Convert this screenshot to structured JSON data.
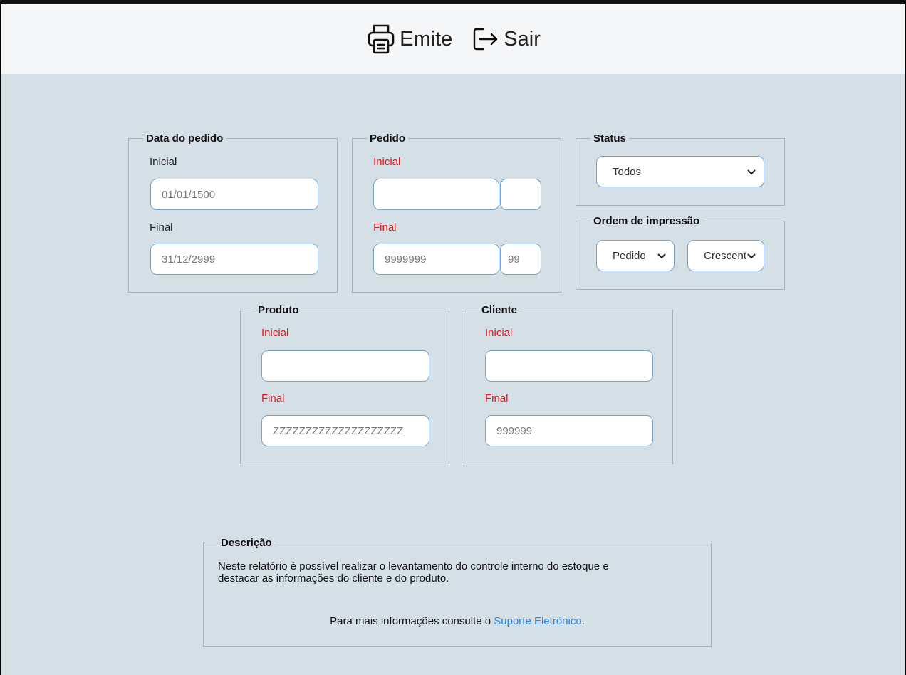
{
  "toolbar": {
    "emit_label": "Emite",
    "exit_label": "Sair"
  },
  "data_pedido": {
    "legend": "Data do pedido",
    "initial_label": "Inicial",
    "initial_placeholder": "01/01/1500",
    "final_label": "Final",
    "final_placeholder": "31/12/2999"
  },
  "pedido": {
    "legend": "Pedido",
    "initial_label": "Inicial",
    "initial_placeholder": "",
    "initial_suffix_placeholder": "",
    "final_label": "Final",
    "final_placeholder": "9999999",
    "final_suffix_placeholder": "99"
  },
  "status": {
    "legend": "Status",
    "selected": "Todos"
  },
  "ordem": {
    "legend": "Ordem de impressão",
    "field_selected": "Pedido",
    "direction_selected": "Crescente"
  },
  "produto": {
    "legend": "Produto",
    "initial_label": "Inicial",
    "initial_placeholder": "",
    "final_label": "Final",
    "final_placeholder": "ZZZZZZZZZZZZZZZZZZZZ"
  },
  "cliente": {
    "legend": "Cliente",
    "initial_label": "Inicial",
    "initial_placeholder": "",
    "final_label": "Final",
    "final_placeholder": "999999"
  },
  "descricao": {
    "legend": "Descrição",
    "line1": "Neste relatório é possível realizar o levantamento do controle interno do estoque e",
    "line2": "destacar as informações do cliente e do produto.",
    "support_prefix": "Para mais informações consulte o ",
    "support_link": "Suporte Eletrônico",
    "support_suffix": "."
  },
  "colors": {
    "background": "#d5dfe6",
    "required_label": "#e8141e",
    "link": "#2a88e0",
    "input_border": "#7ca3c7"
  }
}
